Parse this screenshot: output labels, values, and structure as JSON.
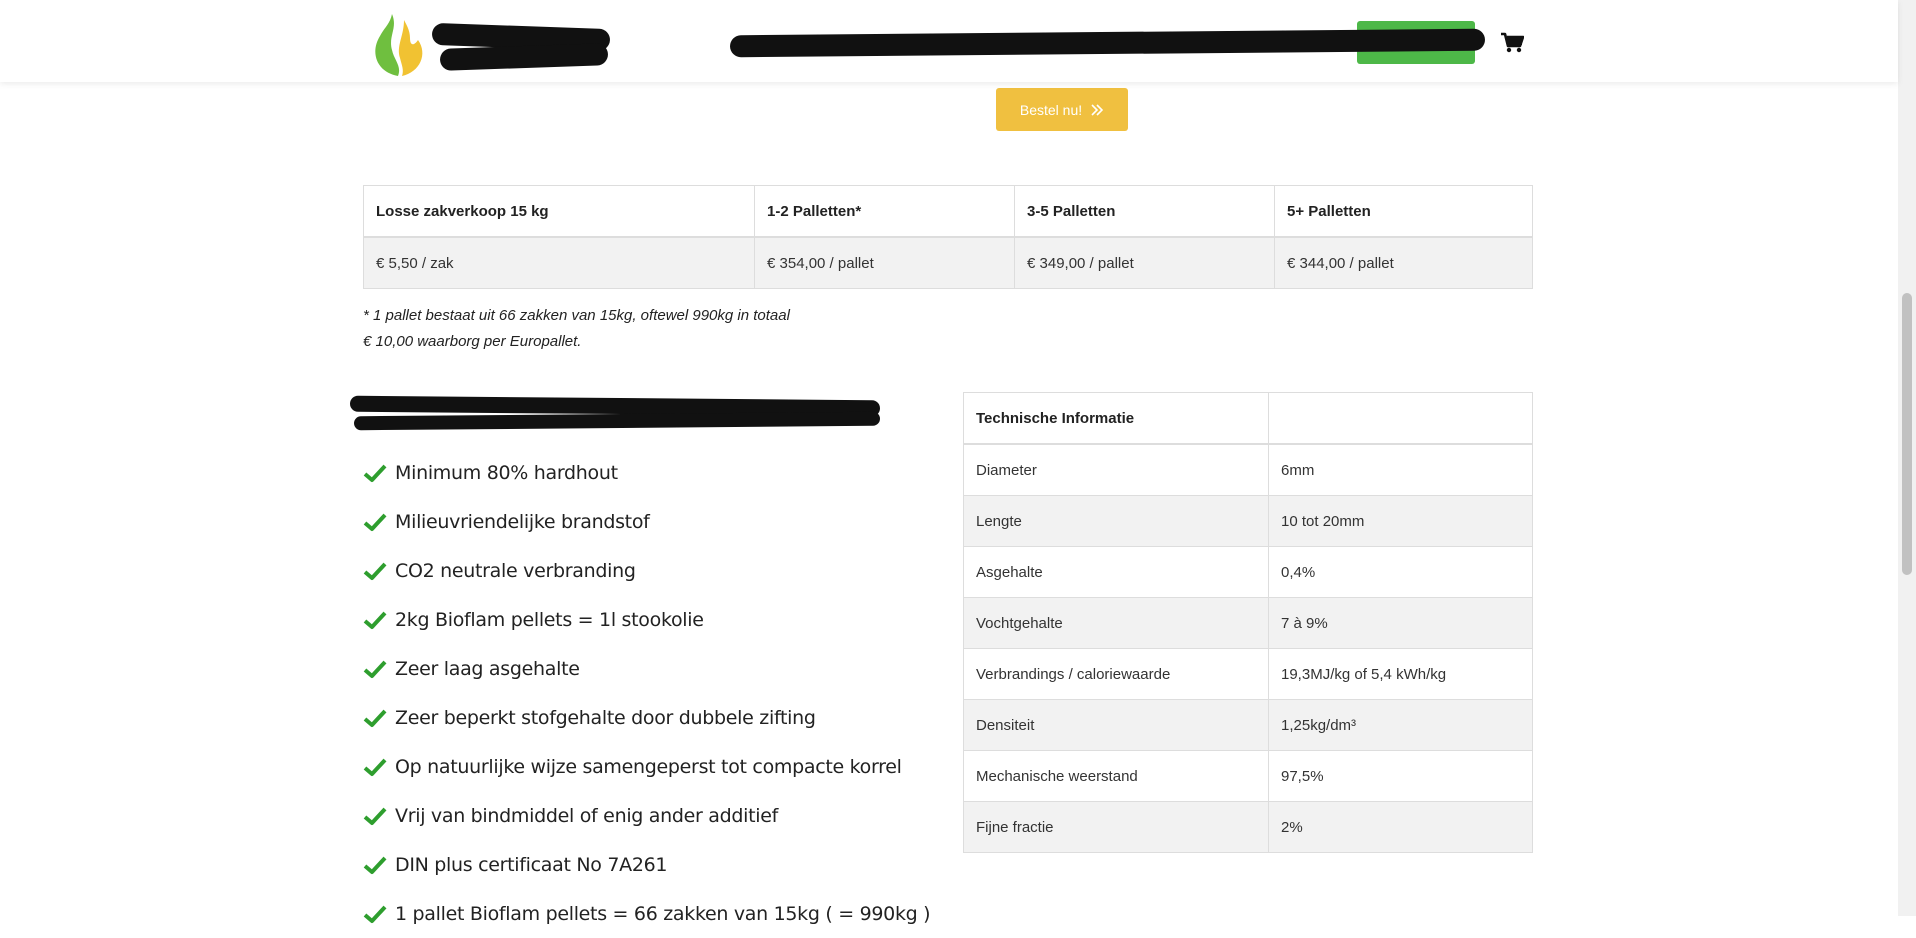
{
  "order_button": {
    "label": "Bestel nu!"
  },
  "price_table": {
    "headers": [
      "Losse zakverkoop 15 kg",
      "1-2 Palletten*",
      "3-5 Palletten",
      "5+ Palletten"
    ],
    "values": [
      "€ 5,50 / zak",
      "€ 354,00 / pallet",
      "€ 349,00 / pallet",
      "€ 344,00 / pallet"
    ]
  },
  "notes": [
    "* 1 pallet bestaat uit 66 zakken van 15kg, oftewel 990kg in totaal",
    "€ 10,00 waarborg per Europallet."
  ],
  "advantages": [
    "Minimum 80% hardhout",
    "Milieuvriendelijke brandstof",
    "CO2 neutrale verbranding",
    "2kg Bioflam pellets = 1l stookolie",
    "Zeer laag asgehalte",
    "Zeer beperkt stofgehalte door dubbele zifting",
    "Op natuurlijke wijze samengeperst tot compacte korrel",
    "Vrij van bindmiddel of enig ander additief",
    "DIN plus certificaat No 7A261",
    "1 pallet Bioflam pellets = 66 zakken van 15kg ( = 990kg )"
  ],
  "tech_table": {
    "header": "Technische Informatie",
    "rows": [
      [
        "Diameter",
        "6mm"
      ],
      [
        "Lengte",
        "10 tot 20mm"
      ],
      [
        "Asgehalte",
        "0,4%"
      ],
      [
        "Vochtgehalte",
        "7 à 9%"
      ],
      [
        "Verbrandings / caloriewaarde",
        "19,3MJ/kg of 5,4 kWh/kg"
      ],
      [
        "Densiteit",
        "1,25kg/dm³"
      ],
      [
        "Mechanische weerstand",
        "97,5%"
      ],
      [
        "Fijne fractie",
        "2%"
      ]
    ]
  },
  "colors": {
    "accent_green": "#4db848",
    "order_yellow": "#f0c040",
    "check_green": "#2e9e2e"
  }
}
